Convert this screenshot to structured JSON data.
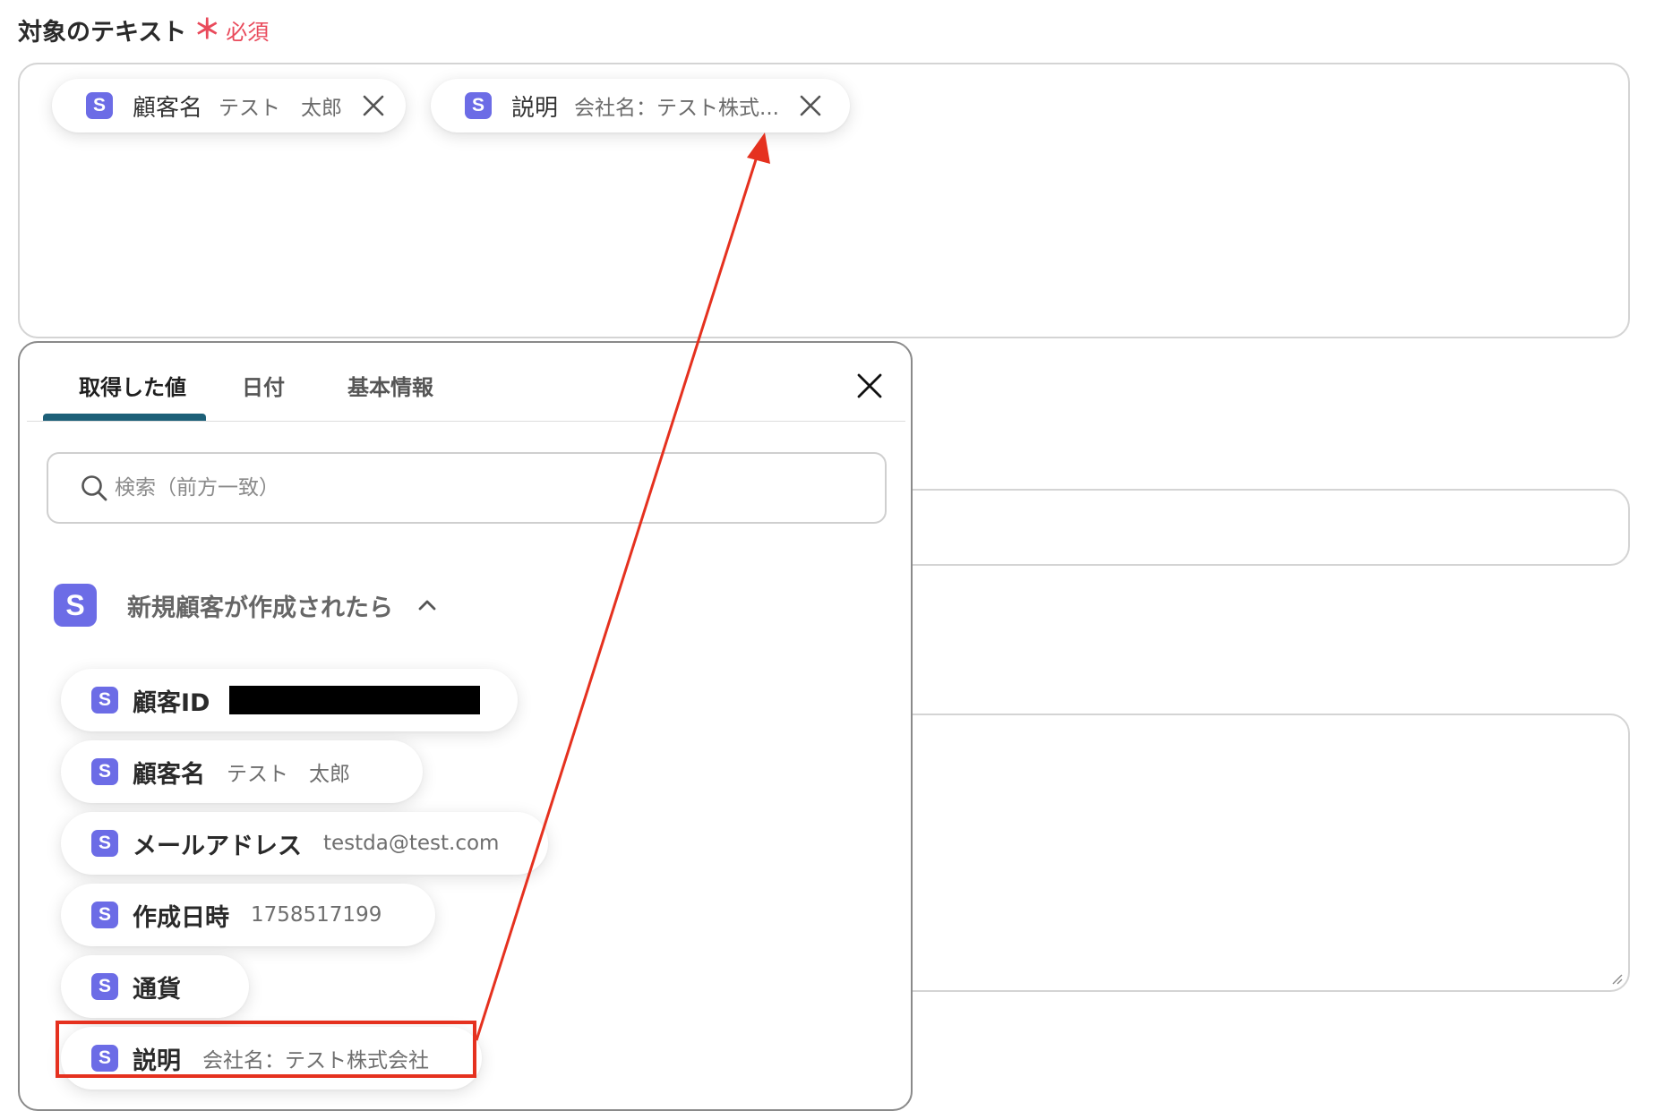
{
  "field": {
    "label": "対象のテキスト",
    "required_star": "＊",
    "required_text": "必須"
  },
  "selected_chips": [
    {
      "source": "S",
      "name": "顧客名",
      "value": "テスト　太郎"
    },
    {
      "source": "S",
      "name": "説明",
      "value": "会社名：テスト株式..."
    }
  ],
  "popup": {
    "tabs": [
      {
        "label": "取得した値",
        "active": true
      },
      {
        "label": "日付",
        "active": false
      },
      {
        "label": "基本情報",
        "active": false
      }
    ],
    "search": {
      "placeholder": "検索（前方一致）",
      "value": ""
    },
    "group": {
      "badge": "S",
      "title": "新規顧客が作成されたら",
      "expanded": true
    },
    "items": [
      {
        "badge": "S",
        "name": "顧客ID",
        "value": "",
        "redacted": true
      },
      {
        "badge": "S",
        "name": "顧客名",
        "value": "テスト　太郎"
      },
      {
        "badge": "S",
        "name": "メールアドレス",
        "value": "testda@test.com"
      },
      {
        "badge": "S",
        "name": "作成日時",
        "value": "1758517199"
      },
      {
        "badge": "S",
        "name": "通貨",
        "value": ""
      },
      {
        "badge": "S",
        "name": "説明",
        "value": "会社名：テスト株式会社"
      }
    ]
  },
  "icons": {
    "source_badge": "stripe-s-icon",
    "remove": "close-icon",
    "popup_close": "close-icon",
    "search": "search-icon",
    "collapse": "chevron-up-icon"
  },
  "colors": {
    "badge": "#6c6ce6",
    "required": "#e94a5b",
    "tab_underline": "#1d6078",
    "annotation": "#e5311f"
  }
}
